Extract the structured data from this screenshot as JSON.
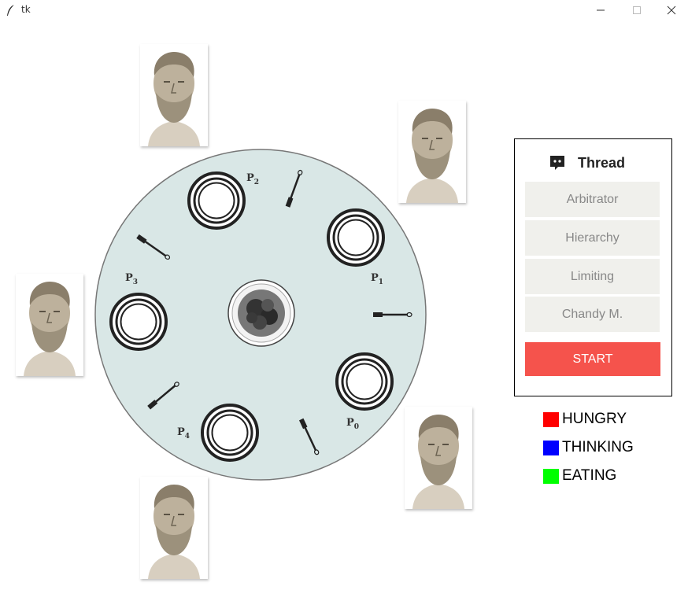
{
  "window": {
    "title": "tk"
  },
  "table": {
    "labels": [
      {
        "letter": "P",
        "sub": "2"
      },
      {
        "letter": "P",
        "sub": "1"
      },
      {
        "letter": "P",
        "sub": "3"
      },
      {
        "letter": "P",
        "sub": "0"
      },
      {
        "letter": "P",
        "sub": "4"
      }
    ]
  },
  "panel": {
    "title": "Thread",
    "options": [
      "Arbitrator",
      "Hierarchy",
      "Limiting",
      "Chandy M."
    ],
    "start_label": "START"
  },
  "legend": [
    {
      "label": "HUNGRY",
      "color": "#ff0000"
    },
    {
      "label": "THINKING",
      "color": "#0000ff"
    },
    {
      "label": "EATING",
      "color": "#00ff00"
    }
  ]
}
